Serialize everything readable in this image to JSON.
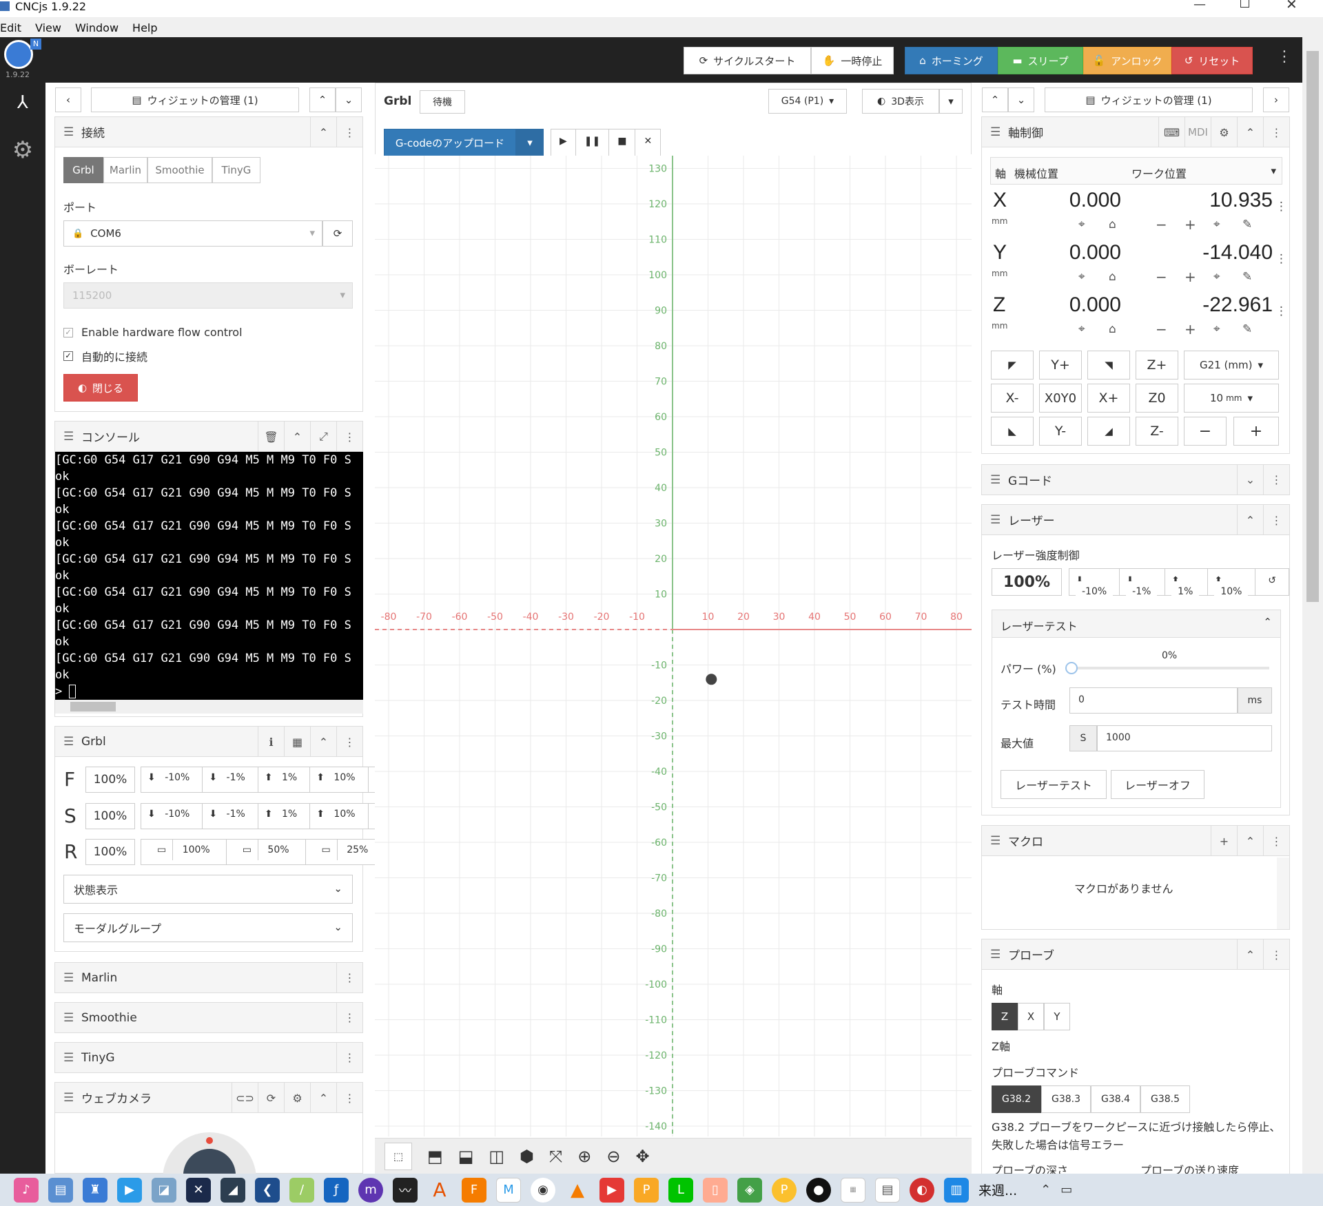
{
  "window": {
    "title": "CNCjs 1.9.22",
    "version": "1.9.22"
  },
  "menu": [
    "Edit",
    "View",
    "Window",
    "Help"
  ],
  "toolbar": {
    "cycle_start": "サイクルスタート",
    "pause": "一時停止",
    "homing": "ホーミング",
    "sleep": "スリープ",
    "unlock": "アンロック",
    "reset": "リセット"
  },
  "left": {
    "manage_widgets": "ウィジェットの管理 (1)",
    "connection": {
      "title": "接続",
      "tabs": [
        "Grbl",
        "Marlin",
        "Smoothie",
        "TinyG"
      ],
      "port_label": "ポート",
      "port_value": "COM6",
      "baud_label": "ボーレート",
      "baud_value": "115200",
      "flow_control": "Enable hardware flow control",
      "auto_connect": "自動的に接続",
      "close": "閉じる"
    },
    "console": {
      "title": "コンソール",
      "lines": [
        "[GC:G0 G54 G17 G21 G90 G94 M5 M M9 T0 F0 S",
        "ok",
        "[GC:G0 G54 G17 G21 G90 G94 M5 M M9 T0 F0 S",
        "ok",
        "[GC:G0 G54 G17 G21 G90 G94 M5 M M9 T0 F0 S",
        "ok",
        "[GC:G0 G54 G17 G21 G90 G94 M5 M M9 T0 F0 S",
        "ok",
        "[GC:G0 G54 G17 G21 G90 G94 M5 M M9 T0 F0 S",
        "ok",
        "[GC:G0 G54 G17 G21 G90 G94 M5 M M9 T0 F0 S",
        "ok",
        "[GC:G0 G54 G17 G21 G90 G94 M5 M M9 T0 F0 S",
        "ok",
        "> "
      ]
    },
    "grbl": {
      "title": "Grbl",
      "f_label": "F",
      "s_label": "S",
      "r_label": "R",
      "f_value": "100%",
      "s_value": "100%",
      "r_value": "100%",
      "m10": "-10%",
      "m1": "-1%",
      "p1": "1%",
      "p10": "10%",
      "r100": "100%",
      "r50": "50%",
      "r25": "25%",
      "status": "状態表示",
      "modal": "モーダルグループ"
    },
    "marlin": "Marlin",
    "smoothie": "Smoothie",
    "tinyg": "TinyG",
    "webcam": "ウェブカメラ"
  },
  "center": {
    "tab_grbl": "Grbl",
    "tab_state": "待機",
    "wcs": "G54 (P1)",
    "view3d": "3D表示",
    "upload": "G-codeのアップロード",
    "xticks": [
      "-80",
      "-70",
      "-60",
      "-50",
      "-40",
      "-30",
      "-20",
      "-10",
      "10",
      "20",
      "30",
      "40",
      "50",
      "60",
      "70",
      "80"
    ],
    "yticks": [
      "130",
      "120",
      "110",
      "100",
      "90",
      "80",
      "70",
      "60",
      "50",
      "40",
      "30",
      "20",
      "10",
      "-10",
      "-20",
      "-30",
      "-40",
      "-50",
      "-60",
      "-70",
      "-80",
      "-90",
      "-100",
      "-110",
      "-120",
      "-130",
      "-140"
    ]
  },
  "right": {
    "manage_widgets": "ウィジェットの管理 (1)",
    "axes": {
      "title": "軸制御",
      "mdi": "MDI",
      "col_axis": "軸",
      "col_machine": "機械位置",
      "col_work": "ワーク位置",
      "unit": "mm",
      "rows": [
        {
          "axis": "X",
          "machine": "0.000",
          "work": "10.935"
        },
        {
          "axis": "Y",
          "machine": "0.000",
          "work": "-14.040"
        },
        {
          "axis": "Z",
          "machine": "0.000",
          "work": "-22.961"
        }
      ],
      "jog": {
        "yplus": "Y+",
        "zplus": "Z+",
        "units": "G21 (mm)",
        "xminus": "X-",
        "x0y0": "X0Y0",
        "xplus": "X+",
        "z0": "Z0",
        "step": "10",
        "step_unit": "mm",
        "yminus": "Y-",
        "zminus": "Z-"
      }
    },
    "gcode": "Gコード",
    "laser": {
      "title": "レーザー",
      "intensity": "レーザー強度制御",
      "value": "100%",
      "m10": "-10%",
      "m1": "-1%",
      "p1": "1%",
      "p10": "10%",
      "test_title": "レーザーテスト",
      "power_label": "パワー (%)",
      "power_value": "0%",
      "time_label": "テスト時間",
      "time_value": "0",
      "time_unit": "ms",
      "max_label": "最大値",
      "max_prefix": "S",
      "max_value": "1000",
      "btn_test": "レーザーテスト",
      "btn_off": "レーザーオフ"
    },
    "macro": {
      "title": "マクロ",
      "empty": "マクロがありません"
    },
    "probe": {
      "title": "プローブ",
      "axis_label": "軸",
      "axes": [
        "Z",
        "X",
        "Y"
      ],
      "z_axis": "Z軸",
      "command_label": "プローブコマンド",
      "commands": [
        "G38.2",
        "G38.3",
        "G38.4",
        "G38.5"
      ],
      "desc": "G38.2 プローブをワークピースに近づけ接触したら停止、失敗した場合は信号エラー",
      "depth": "プローブの深さ",
      "feed": "プローブの送り速度"
    }
  },
  "taskbar": {
    "clock": "来週..."
  }
}
